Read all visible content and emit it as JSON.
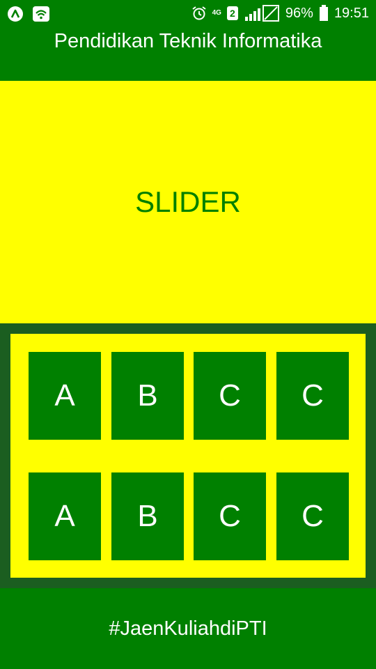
{
  "status_bar": {
    "left_icons": [
      "app-a-icon",
      "wifi-icon"
    ],
    "alarm_icon": "alarm-icon",
    "network_type": "4G",
    "sim_slot": "2",
    "signal_icon": "signal-icon",
    "battery_percent": "96%",
    "time": "19:51"
  },
  "header": {
    "title": "Pendidikan Teknik Informatika"
  },
  "slider": {
    "label": "SLIDER"
  },
  "grid": {
    "rows": [
      [
        "A",
        "B",
        "C",
        "C"
      ],
      [
        "A",
        "B",
        "C",
        "C"
      ]
    ]
  },
  "footer": {
    "hashtag": "#JaenKuliahdiPTI"
  },
  "colors": {
    "primary_green": "#008000",
    "dark_green": "#1b5e20",
    "yellow": "#ffff00",
    "white": "#ffffff"
  }
}
